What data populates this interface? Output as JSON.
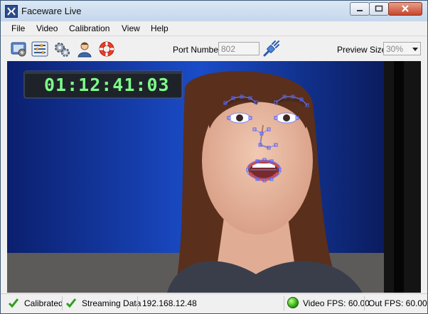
{
  "window": {
    "title": "Faceware Live"
  },
  "menu": {
    "items": [
      "File",
      "Video",
      "Calibration",
      "View",
      "Help"
    ]
  },
  "toolbar": {
    "icons": [
      "camera-settings-icon",
      "sliders-icon",
      "gears-icon",
      "user-icon",
      "help-lifebuoy-icon"
    ],
    "port_label": "Port Number:",
    "port_value": "802",
    "preview_label": "Preview Size:",
    "preview_value": "30%"
  },
  "video": {
    "timecode": "01:12:41:03"
  },
  "status": {
    "calibrated": "Calibrated",
    "streaming": "Streaming Data",
    "ip": "192.168.12.48",
    "video_fps": "Video FPS: 60.00",
    "out_fps": "Out FPS: 60.00"
  },
  "colors": {
    "accent": "#2b4d8a",
    "tracker": "#6a7cff",
    "timecode": "#7dff8a"
  }
}
